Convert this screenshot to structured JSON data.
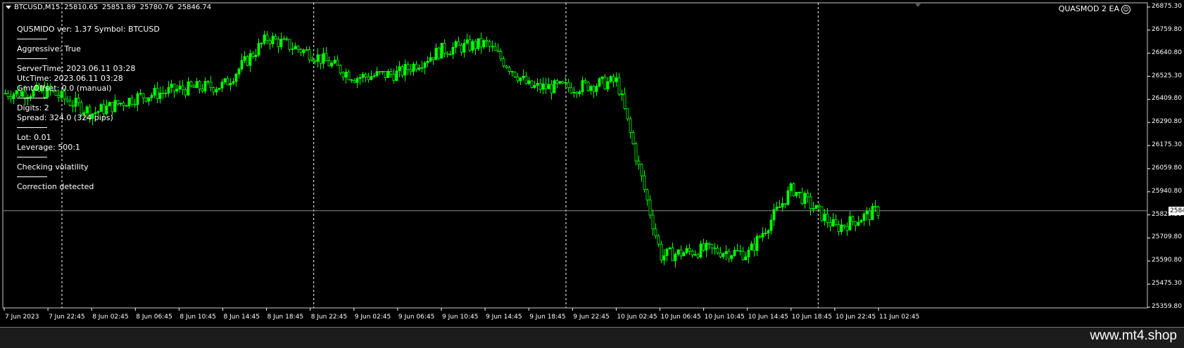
{
  "header": {
    "symbol_tf": "BTCUSD,M15",
    "open": "25810.65",
    "high": "25851.89",
    "low": "25780.76",
    "close": "25846.74"
  },
  "ea_label": "QUASMOD 2 EA",
  "ea_icon": "smiley-icon",
  "info_panel": {
    "version_line": "QUSMIDO ver: 1.37 Symbol: BTCUSD",
    "aggressive": "Aggressive: True",
    "server_time": "ServerTime: 2023.06.11 03:28",
    "utc_time": "UtcTime: 2023.06.11 03:28",
    "gmt_offset": "GmtOffset: 0.0 (manual)",
    "digits": "Digits:  2",
    "spread": "Spread: 324.0 (324 pips)",
    "lot": "Lot:  0.01",
    "leverage": "Leverage: 500:1",
    "volatility": "Checking volatility",
    "correction": "Correction detected"
  },
  "current_price": "25846.74",
  "watermark": "www.mt4.shop",
  "colors": {
    "background": "#000000",
    "candle": "#00ff00",
    "grid": "#ffffff",
    "price_line": "#8c8c8c",
    "text": "#ffffff"
  },
  "chart_data": {
    "type": "line",
    "title": "BTCUSD,M15",
    "y_ticks": [
      "26875.30",
      "26759.80",
      "26640.80",
      "26525.30",
      "26409.80",
      "26290.80",
      "26175.30",
      "26059.80",
      "25940.80",
      "25825.30",
      "25709.80",
      "25590.80",
      "25475.30",
      "25359.80"
    ],
    "x_ticks": [
      "7 Jun 2023",
      "7 Jun 22:45",
      "8 Jun 02:45",
      "8 Jun 06:45",
      "8 Jun 10:45",
      "8 Jun 14:45",
      "8 Jun 18:45",
      "8 Jun 22:45",
      "9 Jun 02:45",
      "9 Jun 06:45",
      "9 Jun 10:45",
      "9 Jun 14:45",
      "9 Jun 18:45",
      "9 Jun 22:45",
      "10 Jun 02:45",
      "10 Jun 06:45",
      "10 Jun 10:45",
      "10 Jun 14:45",
      "10 Jun 18:45",
      "10 Jun 22:45",
      "11 Jun 02:45"
    ],
    "ylim": [
      25359.8,
      26875.3
    ],
    "period_separators": [
      "8 Jun 00:00",
      "9 Jun 00:00",
      "10 Jun 00:00",
      "11 Jun 00:00"
    ],
    "series": [
      {
        "x": [
          "7 Jun 2023",
          "7 Jun 22:45",
          "8 Jun 02:45",
          "8 Jun 06:45",
          "8 Jun 10:45",
          "8 Jun 14:45",
          "8 Jun 18:45",
          "8 Jun 22:45",
          "9 Jun 02:45",
          "9 Jun 06:45",
          "9 Jun 10:45",
          "9 Jun 14:45",
          "9 Jun 18:45",
          "9 Jun 22:45",
          "10 Jun 02:45",
          "10 Jun 06:45",
          "10 Jun 10:45",
          "10 Jun 14:45",
          "10 Jun 18:45",
          "10 Jun 22:45",
          "11 Jun 02:45"
        ],
        "values": [
          26440,
          26450,
          26340,
          26420,
          26460,
          26480,
          26720,
          26640,
          26520,
          26540,
          26660,
          26690,
          26470,
          26470,
          26500,
          25620,
          25650,
          25630,
          25960,
          25760,
          25850
        ]
      }
    ]
  }
}
